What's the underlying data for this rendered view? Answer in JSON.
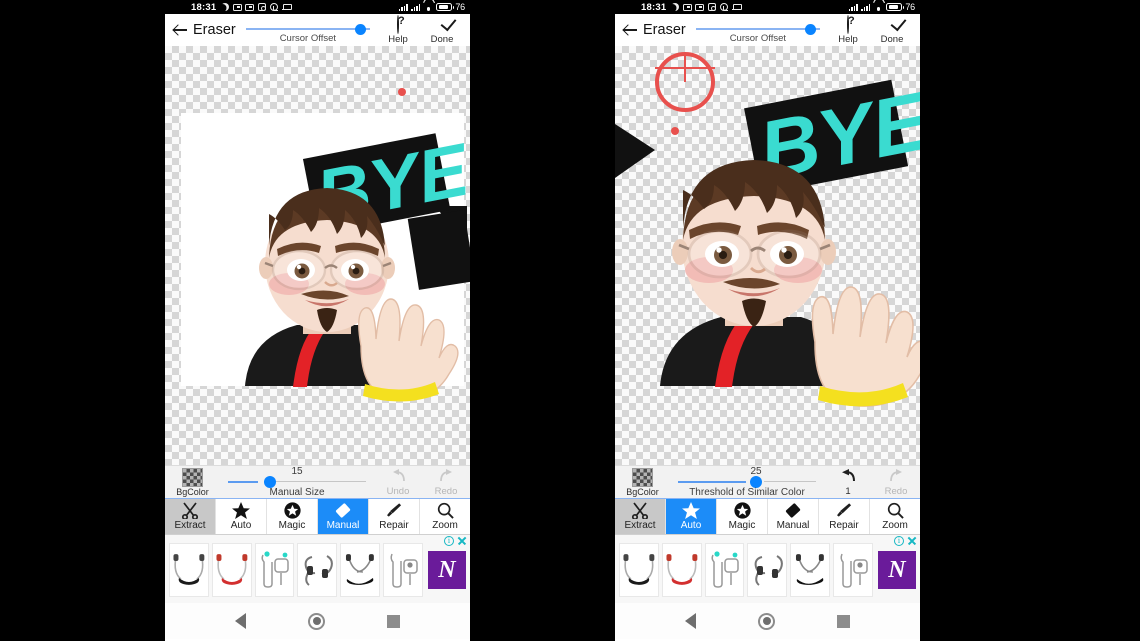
{
  "statusbar": {
    "time": "18:31",
    "battery_pct": "76",
    "icons": [
      "moon-icon",
      "screen-record-icon",
      "screen-record-icon",
      "instagram-icon",
      "whatsapp-icon",
      "laptop-icon",
      "signal-icon",
      "signal-icon",
      "wifi-icon",
      "battery-icon"
    ]
  },
  "header": {
    "back_icon": "back-arrow-icon",
    "title": "Eraser",
    "slider_label": "Cursor Offset",
    "slider_pct": 92,
    "help_label": "Help",
    "help_icon": "question-mark-icon",
    "done_label": "Done",
    "done_icon": "checkmark-icon"
  },
  "artwork": {
    "bye_text": "BYE",
    "bye_color": "#3adbd0",
    "bye_plate_color": "#111111",
    "shirt_color": "#1a1a1a",
    "strap_color": "#e32227",
    "cuff_color": "#f4e01f",
    "hair_color": "#5c3a24",
    "skin_color": "#f6ddcf"
  },
  "left": {
    "canvas": {
      "has_white_background": true,
      "cursor_dot_visible": true,
      "cursor_ring_visible": false
    },
    "toolrow": {
      "bgcolor_label": "BgColor",
      "bgcolor_icon": "checkerboard-swatch",
      "slider_value": "15",
      "slider_label": "Manual Size",
      "slider_pct": 22,
      "undo_label": "Undo",
      "undo_enabled": false,
      "redo_label": "Redo",
      "redo_enabled": false
    },
    "tabs": [
      {
        "label": "Extract",
        "icon": "scissors-icon",
        "state": "gray"
      },
      {
        "label": "Auto",
        "icon": "star-icon",
        "state": "normal"
      },
      {
        "label": "Magic",
        "icon": "magic-star-circle-icon",
        "state": "normal"
      },
      {
        "label": "Manual",
        "icon": "eraser-icon",
        "state": "selected"
      },
      {
        "label": "Repair",
        "icon": "brush-icon",
        "state": "normal"
      },
      {
        "label": "Zoom",
        "icon": "magnifier-icon",
        "state": "normal"
      }
    ]
  },
  "right": {
    "canvas": {
      "has_white_background": false,
      "cursor_dot_visible": true,
      "cursor_ring_visible": true
    },
    "toolrow": {
      "bgcolor_label": "BgColor",
      "bgcolor_icon": "checkerboard-swatch",
      "slider_value": "25",
      "slider_label": "Threshold of Similar Color",
      "slider_pct": 47,
      "undo_label": "1",
      "undo_enabled": true,
      "redo_label": "Redo",
      "redo_enabled": false
    },
    "tabs": [
      {
        "label": "Extract",
        "icon": "scissors-icon",
        "state": "gray"
      },
      {
        "label": "Auto",
        "icon": "star-icon",
        "state": "selected"
      },
      {
        "label": "Magic",
        "icon": "magic-star-circle-icon",
        "state": "normal"
      },
      {
        "label": "Manual",
        "icon": "eraser-icon",
        "state": "normal"
      },
      {
        "label": "Repair",
        "icon": "brush-icon",
        "state": "normal"
      },
      {
        "label": "Zoom",
        "icon": "magnifier-icon",
        "state": "normal"
      }
    ]
  },
  "ad": {
    "info_icon": "ad-info-icon",
    "close_icon": "ad-close-icon",
    "logo_text": "N",
    "logo_color": "#6a1b9a",
    "products": [
      "neckband-black",
      "neckband-red",
      "earbuds-case-1",
      "sport-earhook",
      "neckband-dark",
      "earbuds-case-2"
    ]
  },
  "navbar": {
    "back_icon": "nav-back-icon",
    "home_icon": "nav-home-icon",
    "recents_icon": "nav-recents-icon"
  },
  "colors": {
    "accent": "#0a84ff",
    "accent_track": "#8ab4f3",
    "cursor": "#e8504d",
    "tab_selected": "#1c8cf8"
  }
}
